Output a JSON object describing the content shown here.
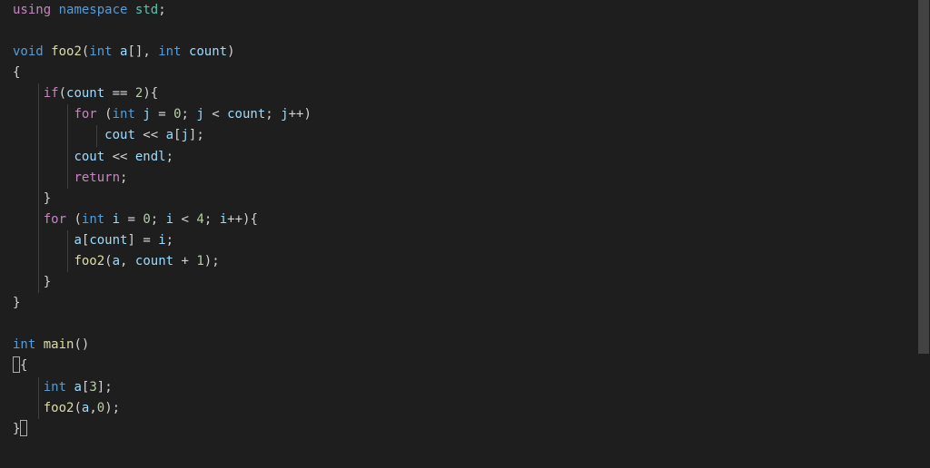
{
  "code": {
    "lines": [
      {
        "tokens": [
          [
            "kw",
            "using"
          ],
          [
            "op",
            " "
          ],
          [
            "kw2",
            "namespace"
          ],
          [
            "op",
            " "
          ],
          [
            "namespace",
            "std"
          ],
          [
            "punc",
            ";"
          ]
        ]
      },
      {
        "tokens": []
      },
      {
        "tokens": [
          [
            "type",
            "void"
          ],
          [
            "op",
            " "
          ],
          [
            "func",
            "foo2"
          ],
          [
            "paren",
            "("
          ],
          [
            "type",
            "int"
          ],
          [
            "op",
            " "
          ],
          [
            "param",
            "a"
          ],
          [
            "paren",
            "[]"
          ],
          [
            "punc",
            ","
          ],
          [
            "op",
            " "
          ],
          [
            "type",
            "int"
          ],
          [
            "op",
            " "
          ],
          [
            "param",
            "count"
          ],
          [
            "paren",
            ")"
          ]
        ]
      },
      {
        "tokens": [
          [
            "punc",
            "{"
          ]
        ]
      },
      {
        "indent": 1,
        "tokens": [
          [
            "op",
            "    "
          ],
          [
            "control",
            "if"
          ],
          [
            "paren",
            "("
          ],
          [
            "var",
            "count"
          ],
          [
            "op",
            " == "
          ],
          [
            "num",
            "2"
          ],
          [
            "paren",
            ")"
          ],
          [
            "punc",
            "{"
          ]
        ]
      },
      {
        "indent": 2,
        "tokens": [
          [
            "op",
            "        "
          ],
          [
            "control",
            "for"
          ],
          [
            "op",
            " "
          ],
          [
            "paren",
            "("
          ],
          [
            "type",
            "int"
          ],
          [
            "op",
            " "
          ],
          [
            "var",
            "j"
          ],
          [
            "op",
            " = "
          ],
          [
            "num",
            "0"
          ],
          [
            "punc",
            ";"
          ],
          [
            "op",
            " "
          ],
          [
            "var",
            "j"
          ],
          [
            "op",
            " < "
          ],
          [
            "var",
            "count"
          ],
          [
            "punc",
            ";"
          ],
          [
            "op",
            " "
          ],
          [
            "var",
            "j"
          ],
          [
            "op",
            "++"
          ],
          [
            "paren",
            ")"
          ]
        ]
      },
      {
        "indent": 3,
        "tokens": [
          [
            "op",
            "            "
          ],
          [
            "var",
            "cout"
          ],
          [
            "op",
            " << "
          ],
          [
            "var",
            "a"
          ],
          [
            "paren",
            "["
          ],
          [
            "var",
            "j"
          ],
          [
            "paren",
            "]"
          ],
          [
            "punc",
            ";"
          ]
        ]
      },
      {
        "indent": 2,
        "tokens": [
          [
            "op",
            "        "
          ],
          [
            "var",
            "cout"
          ],
          [
            "op",
            " << "
          ],
          [
            "var",
            "endl"
          ],
          [
            "punc",
            ";"
          ]
        ]
      },
      {
        "indent": 2,
        "tokens": [
          [
            "op",
            "        "
          ],
          [
            "control",
            "return"
          ],
          [
            "punc",
            ";"
          ]
        ]
      },
      {
        "indent": 1,
        "tokens": [
          [
            "op",
            "    "
          ],
          [
            "punc",
            "}"
          ]
        ]
      },
      {
        "indent": 1,
        "tokens": [
          [
            "op",
            "    "
          ],
          [
            "control",
            "for"
          ],
          [
            "op",
            " "
          ],
          [
            "paren",
            "("
          ],
          [
            "type",
            "int"
          ],
          [
            "op",
            " "
          ],
          [
            "var",
            "i"
          ],
          [
            "op",
            " = "
          ],
          [
            "num",
            "0"
          ],
          [
            "punc",
            ";"
          ],
          [
            "op",
            " "
          ],
          [
            "var",
            "i"
          ],
          [
            "op",
            " < "
          ],
          [
            "num",
            "4"
          ],
          [
            "punc",
            ";"
          ],
          [
            "op",
            " "
          ],
          [
            "var",
            "i"
          ],
          [
            "op",
            "++"
          ],
          [
            "paren",
            ")"
          ],
          [
            "punc",
            "{"
          ]
        ]
      },
      {
        "indent": 2,
        "tokens": [
          [
            "op",
            "        "
          ],
          [
            "var",
            "a"
          ],
          [
            "paren",
            "["
          ],
          [
            "var",
            "count"
          ],
          [
            "paren",
            "]"
          ],
          [
            "op",
            " = "
          ],
          [
            "var",
            "i"
          ],
          [
            "punc",
            ";"
          ]
        ]
      },
      {
        "indent": 2,
        "tokens": [
          [
            "op",
            "        "
          ],
          [
            "func",
            "foo2"
          ],
          [
            "paren",
            "("
          ],
          [
            "var",
            "a"
          ],
          [
            "punc",
            ","
          ],
          [
            "op",
            " "
          ],
          [
            "var",
            "count"
          ],
          [
            "op",
            " + "
          ],
          [
            "num",
            "1"
          ],
          [
            "paren",
            ")"
          ],
          [
            "punc",
            ";"
          ]
        ]
      },
      {
        "indent": 1,
        "tokens": [
          [
            "op",
            "    "
          ],
          [
            "punc",
            "}"
          ]
        ]
      },
      {
        "tokens": [
          [
            "punc",
            "}"
          ]
        ]
      },
      {
        "tokens": []
      },
      {
        "tokens": [
          [
            "type",
            "int"
          ],
          [
            "op",
            " "
          ],
          [
            "func",
            "main"
          ],
          [
            "paren",
            "()"
          ]
        ]
      },
      {
        "cursor": true,
        "tokens": [
          [
            "punc",
            "{"
          ]
        ]
      },
      {
        "indent": 1,
        "tokens": [
          [
            "op",
            "    "
          ],
          [
            "type",
            "int"
          ],
          [
            "op",
            " "
          ],
          [
            "var",
            "a"
          ],
          [
            "paren",
            "["
          ],
          [
            "num",
            "3"
          ],
          [
            "paren",
            "]"
          ],
          [
            "punc",
            ";"
          ]
        ]
      },
      {
        "indent": 1,
        "tokens": [
          [
            "op",
            "    "
          ],
          [
            "func",
            "foo2"
          ],
          [
            "paren",
            "("
          ],
          [
            "var",
            "a"
          ],
          [
            "punc",
            ","
          ],
          [
            "num",
            "0"
          ],
          [
            "paren",
            ")"
          ],
          [
            "punc",
            ";"
          ]
        ]
      },
      {
        "endcursor": true,
        "tokens": [
          [
            "punc",
            "}"
          ]
        ]
      }
    ]
  }
}
